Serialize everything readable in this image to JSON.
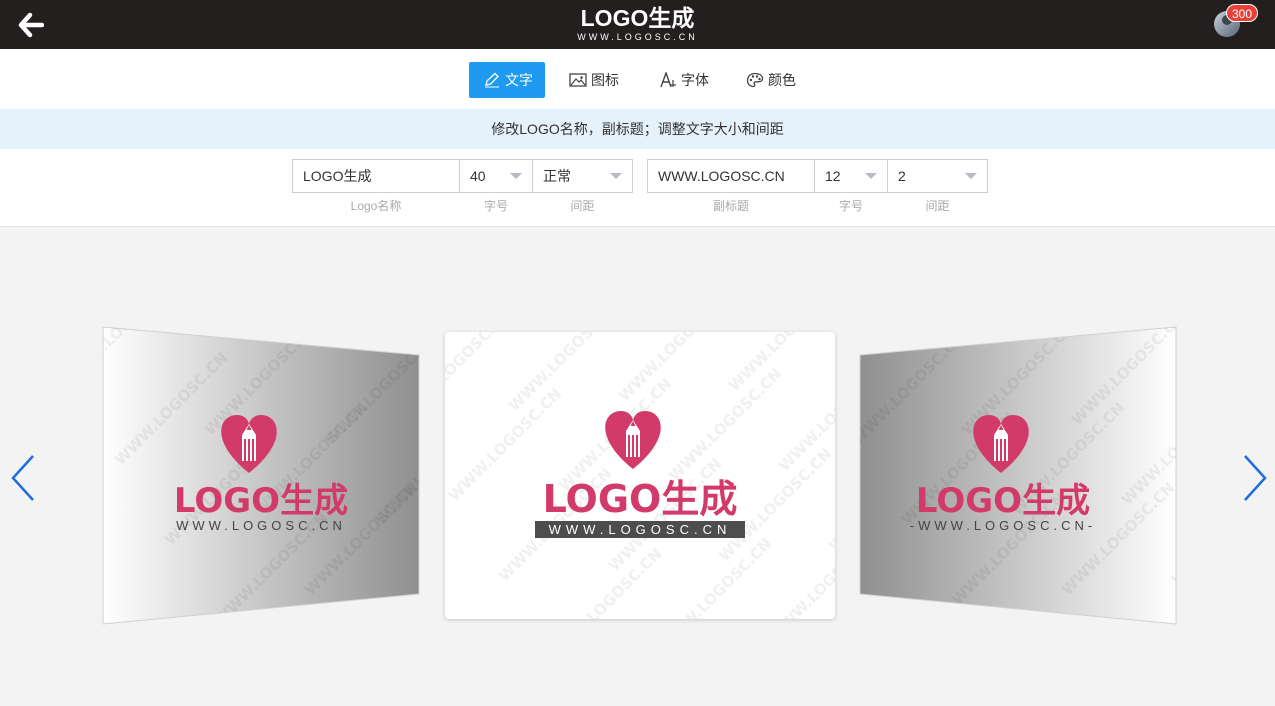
{
  "header": {
    "brand_title": "LOGO生成",
    "brand_subtitle": "WWW.LOGOSC.CN",
    "credits_badge": "300"
  },
  "tabs": [
    {
      "label": "文字",
      "icon": "pencil-icon",
      "active": true
    },
    {
      "label": "图标",
      "icon": "image-icon",
      "active": false
    },
    {
      "label": "字体",
      "icon": "font-icon",
      "active": false
    },
    {
      "label": "颜色",
      "icon": "palette-icon",
      "active": false
    }
  ],
  "hint": "修改LOGO名称，副标题；调整文字大小和间距",
  "form": {
    "name_value": "LOGO生成",
    "name_label": "Logo名称",
    "name_size": "40",
    "name_size_label": "字号",
    "name_spacing": "正常",
    "name_spacing_label": "间距",
    "subtitle_value": "WWW.LOGOSC.CN",
    "subtitle_label": "副标题",
    "subtitle_size": "12",
    "subtitle_size_label": "字号",
    "subtitle_spacing": "2",
    "subtitle_spacing_label": "间距"
  },
  "preview": {
    "watermark_text": "WWW.LOGOSC.CN",
    "logo_word": "LOGO生成",
    "center_url": "WWW.LOGOSC.CN",
    "left_url": "WWW.LOGOSC.CN",
    "right_url": "-WWW.LOGOSC.CN-"
  },
  "colors": {
    "header_bg": "#231f1e",
    "accent_blue": "#1e9bf0",
    "logo_pink": "#d23a6a",
    "badge_red": "#e8413a",
    "hint_bg": "#e5f1fb"
  }
}
